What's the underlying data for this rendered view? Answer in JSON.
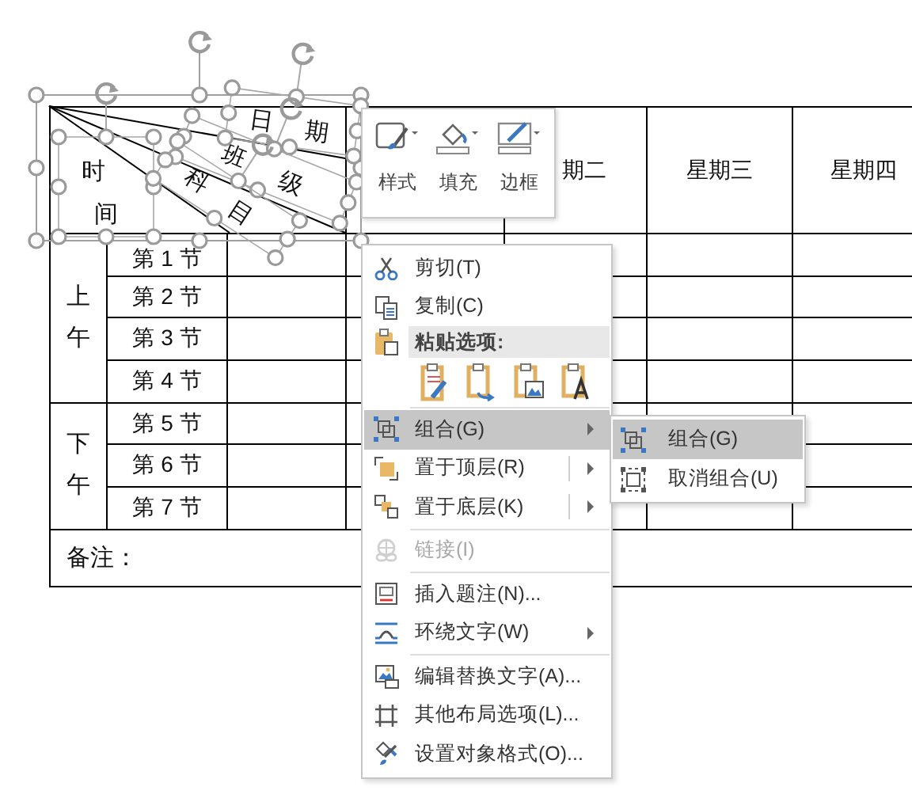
{
  "mini_toolbar": {
    "buttons": [
      {
        "label": "样式"
      },
      {
        "label": "填充"
      },
      {
        "label": "边框"
      }
    ]
  },
  "table": {
    "corner_text_boxes": [
      [
        "时",
        "间"
      ],
      [
        "日",
        "期"
      ],
      [
        "班",
        "级"
      ],
      [
        "科",
        "目"
      ]
    ],
    "columns": [
      "期二",
      "星期三",
      "星期四"
    ],
    "sessions": [
      {
        "label": "上午",
        "periods": [
          "第 1 节",
          "第 2 节",
          "第 3 节",
          "第 4 节"
        ]
      },
      {
        "label": "下午",
        "periods": [
          "第 5 节",
          "第 6 节",
          "第 7 节"
        ]
      }
    ],
    "note": "备注："
  },
  "context_menu": {
    "items": [
      {
        "kind": "item",
        "label": "剪切(T)",
        "selected": false,
        "disabled": false,
        "submenu": false,
        "split": false
      },
      {
        "kind": "item",
        "label": "复制(C)",
        "selected": false,
        "disabled": false,
        "submenu": false,
        "split": false
      },
      {
        "kind": "header",
        "label": "粘贴选项:"
      },
      {
        "kind": "paste-options"
      },
      {
        "kind": "separator"
      },
      {
        "kind": "item",
        "label": "组合(G)",
        "selected": true,
        "disabled": false,
        "submenu": true,
        "split": false
      },
      {
        "kind": "item",
        "label": "置于顶层(R)",
        "selected": false,
        "disabled": false,
        "submenu": true,
        "split": true
      },
      {
        "kind": "item",
        "label": "置于底层(K)",
        "selected": false,
        "disabled": false,
        "submenu": true,
        "split": true
      },
      {
        "kind": "separator"
      },
      {
        "kind": "item",
        "label": "链接(I)",
        "selected": false,
        "disabled": true,
        "submenu": false,
        "split": false
      },
      {
        "kind": "separator"
      },
      {
        "kind": "item",
        "label": "插入题注(N)...",
        "selected": false,
        "disabled": false,
        "submenu": false,
        "split": false
      },
      {
        "kind": "item",
        "label": "环绕文字(W)",
        "selected": false,
        "disabled": false,
        "submenu": true,
        "split": false
      },
      {
        "kind": "separator"
      },
      {
        "kind": "item",
        "label": "编辑替换文字(A)...",
        "selected": false,
        "disabled": false,
        "submenu": false,
        "split": false
      },
      {
        "kind": "item",
        "label": "其他布局选项(L)...",
        "selected": false,
        "disabled": false,
        "submenu": false,
        "split": false
      },
      {
        "kind": "item",
        "label": "设置对象格式(O)...",
        "selected": false,
        "disabled": false,
        "submenu": false,
        "split": false
      }
    ]
  },
  "submenu": {
    "items": [
      {
        "label": "组合(G)",
        "selected": true
      },
      {
        "label": "取消组合(U)",
        "selected": false
      }
    ]
  }
}
